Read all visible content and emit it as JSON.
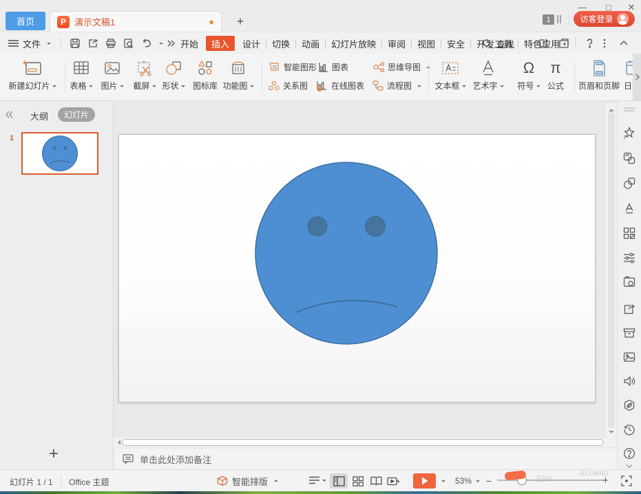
{
  "titlebar": {
    "home_tab": "首页",
    "doc_tab_title": "演示文稿1",
    "unsaved_dot": "●",
    "new_tab": "+",
    "minimize": "—",
    "maximize": "□",
    "close": "✕",
    "task_badge": "1",
    "login_label": "访客登录"
  },
  "menubar": {
    "file_label": "文件",
    "tabs": [
      {
        "label": "开始",
        "active": false
      },
      {
        "label": "插入",
        "active": true
      },
      {
        "label": "设计",
        "active": false
      },
      {
        "label": "切换",
        "active": false
      },
      {
        "label": "动画",
        "active": false
      },
      {
        "label": "幻灯片放映",
        "active": false
      },
      {
        "label": "审阅",
        "active": false
      },
      {
        "label": "视图",
        "active": false
      },
      {
        "label": "安全",
        "active": false
      },
      {
        "label": "开发工具",
        "active": false
      },
      {
        "label": "特色应用",
        "active": false
      }
    ],
    "search_label": "查找"
  },
  "ribbon": {
    "new_slide": "新建幻灯片",
    "table": "表格",
    "picture": "图片",
    "screenshot": "截屏",
    "shapes": "形状",
    "icon_library": "图标库",
    "function_diagram": "功能图",
    "smart_graphics": "智能图形",
    "chart": "图表",
    "mind_map": "思维导图",
    "relation_diagram": "关系图",
    "online_chart": "在线图表",
    "flow_chart": "流程图",
    "text_box": "文本框",
    "word_art": "艺术字",
    "symbol": "符号",
    "symbol_glyph": "Ω",
    "formula": "公式",
    "formula_glyph": "π",
    "header_footer": "页眉和页脚",
    "date_partial": "日期"
  },
  "left_panel": {
    "outline_tab": "大纲",
    "slides_tab": "幻灯片",
    "slide_number": "1",
    "add_slide": "+"
  },
  "notes": {
    "placeholder": "单击此处添加备注"
  },
  "statusbar": {
    "slide_counter": "幻灯片 1 / 1",
    "theme": "Office 主题",
    "smart_layout": "智能排版",
    "zoom_value": "53%",
    "zoom_ghost": "53%",
    "zoom_out": "−",
    "zoom_in": "+",
    "watermark": "JUJUMAO"
  },
  "colors": {
    "accent_orange": "#E8542C",
    "tab_blue": "#4E9CE8",
    "login_red": "#DD4630",
    "play_orange": "#F2643E",
    "face_fill": "#4E8FD3",
    "face_stroke": "#3E6E9E",
    "eye_fill": "#45749F",
    "selection_border": "#DB5A2D"
  }
}
